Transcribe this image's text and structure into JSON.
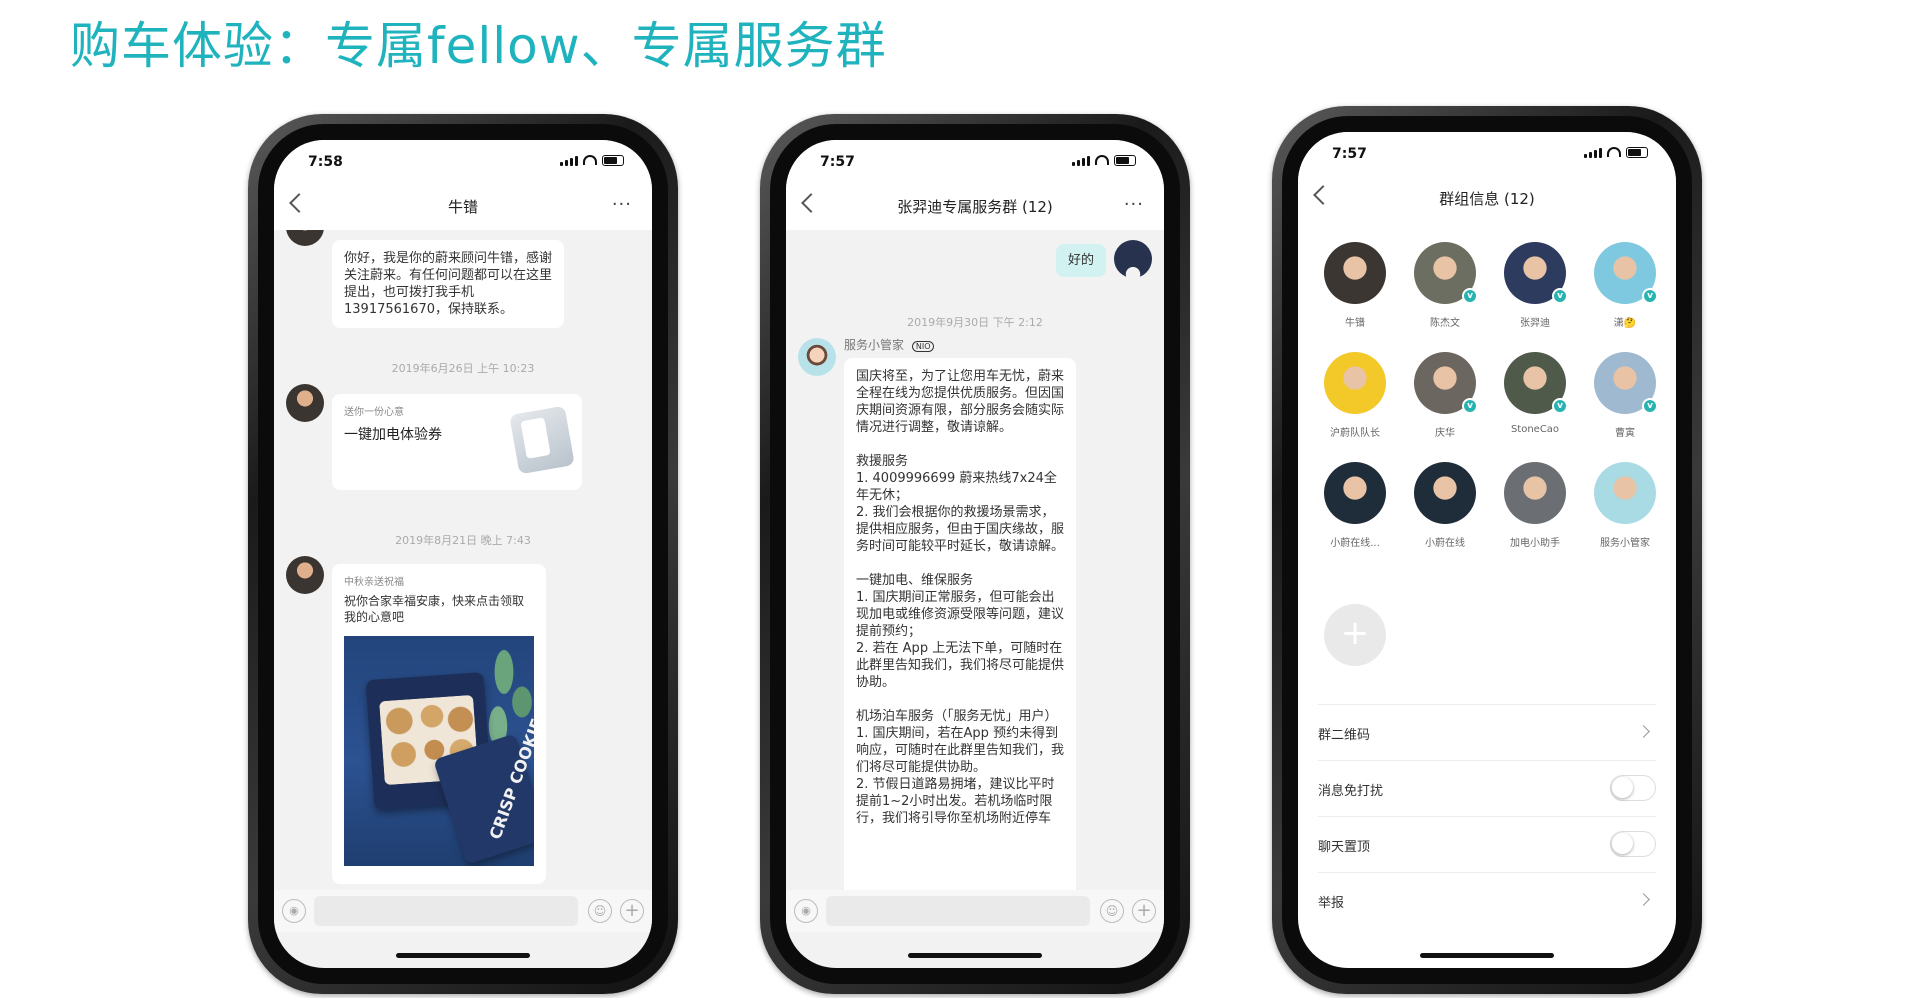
{
  "slide": {
    "title": "购车体验：专属fellow、专属服务群"
  },
  "phones": {
    "p1": {
      "time": "7:58",
      "nav_title": "牛镨",
      "msg1": "你好，我是你的蔚来顾问牛镨，感谢关注蔚来。有任何问题都可以在这里提出，也可拨打我手机13917561670，保持联系。",
      "ts1": "2019年6月26日 上午 10:23",
      "card_sub": "送你一份心意",
      "card_main": "一键加电体验券",
      "ts2": "2019年8月21日 晚上 7:43",
      "card2_sub": "中秋亲送祝福",
      "card2_text": "祝你合家幸福安康，快来点击领取我的心意吧",
      "cookie_label": "CRISP COOKIE"
    },
    "p2": {
      "time": "7:57",
      "nav_title": "张羿迪专属服务群 (12)",
      "my_reply": "好的",
      "ts": "2019年9月30日 下午 2:12",
      "sender": "服务小管家",
      "sender_tag": "NIO",
      "msg": [
        "国庆将至，为了让您用车无忧，蔚来全程在线为您提供优质服务。但因国庆期间资源有限，部分服务会随实际情况进行调整，敬请谅解。",
        "救援服务",
        "1. 4009996699 蔚来热线7x24全年无休；",
        "2. 我们会根据你的救援场景需求，提供相应服务，但由于国庆缘故，服务时间可能较平时延长，敬请谅解。",
        "一键加电、维保服务",
        "1. 国庆期间正常服务，但可能会出现加电或维修资源受限等问题，建议提前预约；",
        "2. 若在 App 上无法下单，可随时在此群里告知我们，我们将尽可能提供协助。",
        "机场泊车服务（「服务无忧」用户）",
        "1. 国庆期间，若在App 预约未得到响应，可随时在此群里告知我们，我们将尽可能提供协助。",
        "2. 节假日道路易拥堵，建议比平时提前1~2小时出发。若机场临时限行，我们将引导你至机场附近停车"
      ]
    },
    "p3": {
      "time": "7:57",
      "nav_title": "群组信息 (12)",
      "members": [
        {
          "name": "牛镨",
          "verified": false,
          "color": "#3b3631"
        },
        {
          "name": "陈杰文",
          "verified": true,
          "color": "#6b6e60"
        },
        {
          "name": "张羿迪",
          "verified": true,
          "color": "#2d3b5e"
        },
        {
          "name": "潇🤔",
          "verified": true,
          "color": "#7ec9e0"
        },
        {
          "name": "沪蔚队队长",
          "verified": false,
          "color": "#f3c92a"
        },
        {
          "name": "庆华",
          "verified": true,
          "color": "#6c6660"
        },
        {
          "name": "StoneCao",
          "verified": true,
          "color": "#4f5a4b"
        },
        {
          "name": "曹寅",
          "verified": true,
          "color": "#9fb9d0"
        },
        {
          "name": "小蔚在线...",
          "verified": false,
          "color": "#1f2d3a"
        },
        {
          "name": "小蔚在线",
          "verified": false,
          "color": "#1f2d3a"
        },
        {
          "name": "加电小助手",
          "verified": false,
          "color": "#6b6f74"
        },
        {
          "name": "服务小管家",
          "verified": false,
          "color": "#a8dbe3"
        }
      ],
      "add_label": "+",
      "rows": {
        "qrcode": "群二维码",
        "mute": "消息免打扰",
        "pin": "聊天置顶",
        "report": "举报"
      }
    }
  },
  "icons": {
    "back": "chevron-left-icon",
    "more": "more-icon",
    "mic": "microphone-icon",
    "emoji": "emoji-icon",
    "plus": "plus-icon"
  },
  "colors": {
    "title": "#1fb3bd",
    "verified": "#27b4b0"
  }
}
